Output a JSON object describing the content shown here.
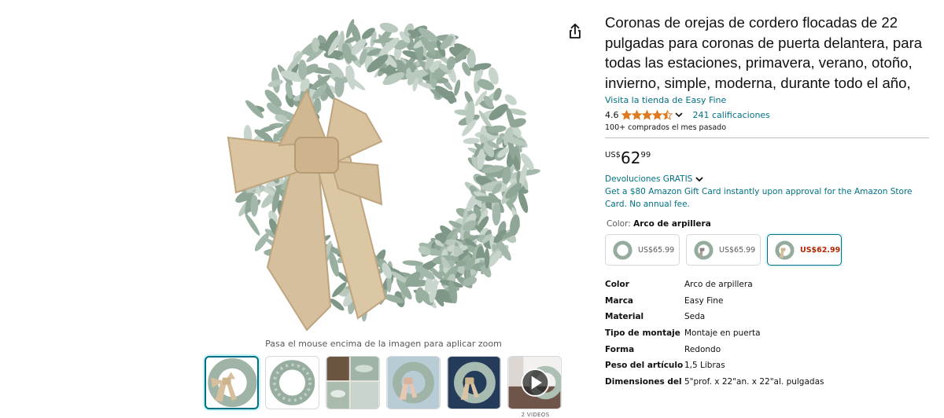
{
  "product": {
    "title": "Coronas de orejas de cordero flocadas de 22 pulgadas para coronas de puerta delantera, para todas las estaciones, primavera, verano, otoño, invierno, simple, moderna, durante todo el año,",
    "store_link": "Visita la tienda de Easy Fine",
    "rating_value": "4.6",
    "rating_stars": 4.5,
    "ratings_count": "241 calificaciones",
    "bought_text": "100+ comprados el mes pasado"
  },
  "price": {
    "symbol": "US$",
    "whole": "62",
    "fraction": "99"
  },
  "returns": {
    "label": "Devoluciones GRATIS"
  },
  "promo": {
    "text": "Get a $80 Amazon Gift Card instantly upon approval for the Amazon Store Card. No annual fee."
  },
  "color": {
    "label": "Color:",
    "selected": "Arco de arpillera",
    "options": [
      {
        "price": "US$65.99",
        "selected": false
      },
      {
        "price": "US$65.99",
        "selected": false
      },
      {
        "price": "US$62.99",
        "selected": true
      }
    ]
  },
  "specs": [
    {
      "key": "Color",
      "value": "Arco de arpillera"
    },
    {
      "key": "Marca",
      "value": "Easy Fine"
    },
    {
      "key": "Material",
      "value": "Seda"
    },
    {
      "key": "Tipo de montaje",
      "value": "Montaje en puerta"
    },
    {
      "key": "Forma",
      "value": "Redondo"
    },
    {
      "key": "Peso del artículo",
      "value": "1,5 Libras"
    },
    {
      "key": "Dimensiones del",
      "value": "5\"prof. x 22\"an. x 22\"al. pulgadas"
    }
  ],
  "gallery": {
    "zoom_hint": "Pasa el mouse encima de la imagen para aplicar zoom",
    "video_count": "2 VIDEOS",
    "thumbnails": [
      "wreath-with-bow",
      "wreath-plain",
      "leaf-closeup",
      "wreath-lifestyle-blue",
      "wreath-on-navy-door",
      "video-thumbnail"
    ]
  },
  "icons": {
    "share": "share-icon",
    "play": "play-icon",
    "chevron": "chevron-down-icon",
    "star": "star-icon"
  },
  "colors": {
    "link": "#007185",
    "price_red": "#b12704",
    "star": "#de7921",
    "leaf": "#9fb3a6",
    "burlap": "#d9c4a3"
  }
}
